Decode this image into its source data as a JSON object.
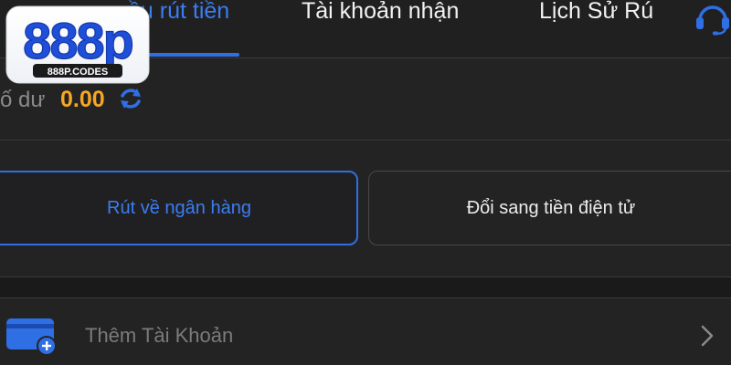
{
  "tabs": [
    {
      "label": "ầu rút tiền",
      "active": true
    },
    {
      "label": "Tài khoản nhận",
      "active": false
    },
    {
      "label": "Lịch Sử Rú",
      "active": false
    }
  ],
  "logo": {
    "brand": "888p",
    "domain": "888P.CODES"
  },
  "balance": {
    "label": "ố dư",
    "value": "0.00"
  },
  "options": {
    "bank": "Rút về ngân hàng",
    "crypto": "Đổi sang tiền điện tử"
  },
  "add_account": {
    "label": "Thêm Tài Khoản"
  },
  "colors": {
    "accent_blue": "#2f6fe4",
    "balance_orange": "#f5a623",
    "logo_blue": "#1e4fd8",
    "background": "#232324"
  },
  "icons": [
    "support-headset-icon",
    "refresh-icon",
    "wallet-add-icon",
    "chevron-right-icon"
  ]
}
